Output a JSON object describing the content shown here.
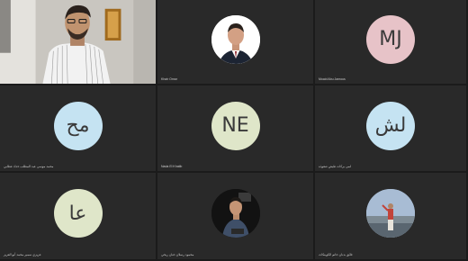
{
  "participants": [
    {
      "name": "",
      "type": "video"
    },
    {
      "name": "Khair Omar",
      "type": "photo",
      "photo": "man-in-suit"
    },
    {
      "name": "Moaid Abu Jamous",
      "type": "initials",
      "initials": "MJ",
      "color": "#e7c3c8"
    },
    {
      "name": "محمد موسى عبد المطلب حداد عطابي",
      "type": "initials",
      "initials": "مح",
      "color": "#c5e3f2"
    },
    {
      "name": "Nada El Khatib",
      "type": "initials",
      "initials": "NE",
      "color": "#dfe6c9"
    },
    {
      "name": "لمى بركات طيش صغوذه",
      "type": "initials",
      "initials": "لش",
      "color": "#c5e3f2"
    },
    {
      "name": "عزيزي سمير محمد أبو العزيز",
      "type": "initials",
      "initials": "عا",
      "color": "#dfe6c9"
    },
    {
      "name": "محمود رسلان حنان ريحي",
      "type": "photo",
      "photo": "man-on-dark"
    },
    {
      "name": "فائق بدنان حاتم الكوينكاث",
      "type": "photo",
      "photo": "person-outdoors"
    }
  ],
  "colors": {
    "tile_bg": "#292929",
    "grid_bg": "#1e1e1e"
  }
}
